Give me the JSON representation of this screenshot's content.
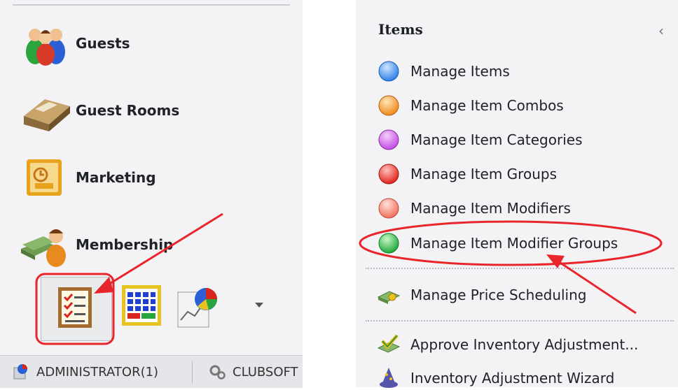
{
  "left_panel": {
    "nav_items": [
      {
        "label": "Guests",
        "icon": "guests-icon"
      },
      {
        "label": "Guest Rooms",
        "icon": "guest-rooms-icon"
      },
      {
        "label": "Marketing",
        "icon": "marketing-icon"
      },
      {
        "label": "Membership",
        "icon": "membership-icon"
      }
    ],
    "shortcuts": [
      "checklist-icon",
      "calendar-grid-icon",
      "pie-chart-report-icon"
    ],
    "status_bar": {
      "user": "ADMINISTRATOR(1)",
      "app": "CLUBSOFT"
    }
  },
  "right_panel": {
    "title": "Items",
    "collapse_glyph": "‹",
    "menu_items": [
      {
        "label": "Manage Items",
        "icon": "blue-orb-icon",
        "color": "#2f7fe6"
      },
      {
        "label": "Manage Item Combos",
        "icon": "orange-orb-icon",
        "color": "#f08a1a"
      },
      {
        "label": "Manage Item Categories",
        "icon": "purple-orb-icon",
        "color": "#c24be0"
      },
      {
        "label": "Manage Item Groups",
        "icon": "red-orb-icon",
        "color": "#e0241e"
      },
      {
        "label": "Manage Item Modifiers",
        "icon": "salmon-orb-icon",
        "color": "#f0705e"
      },
      {
        "label": "Manage Item Modifier Groups",
        "icon": "green-orb-icon",
        "color": "#1fa83a"
      },
      {
        "label": "Manage Price Scheduling",
        "icon": "money-icon",
        "color": "#6b9a4e"
      },
      {
        "label": "Approve Inventory Adjustment...",
        "icon": "approve-check-icon",
        "color": "#3f8f2a"
      },
      {
        "label": "Inventory Adjustment Wizard",
        "icon": "wizard-icon",
        "color": "#5555aa"
      }
    ]
  },
  "annotation": {
    "color": "#e8252a"
  }
}
